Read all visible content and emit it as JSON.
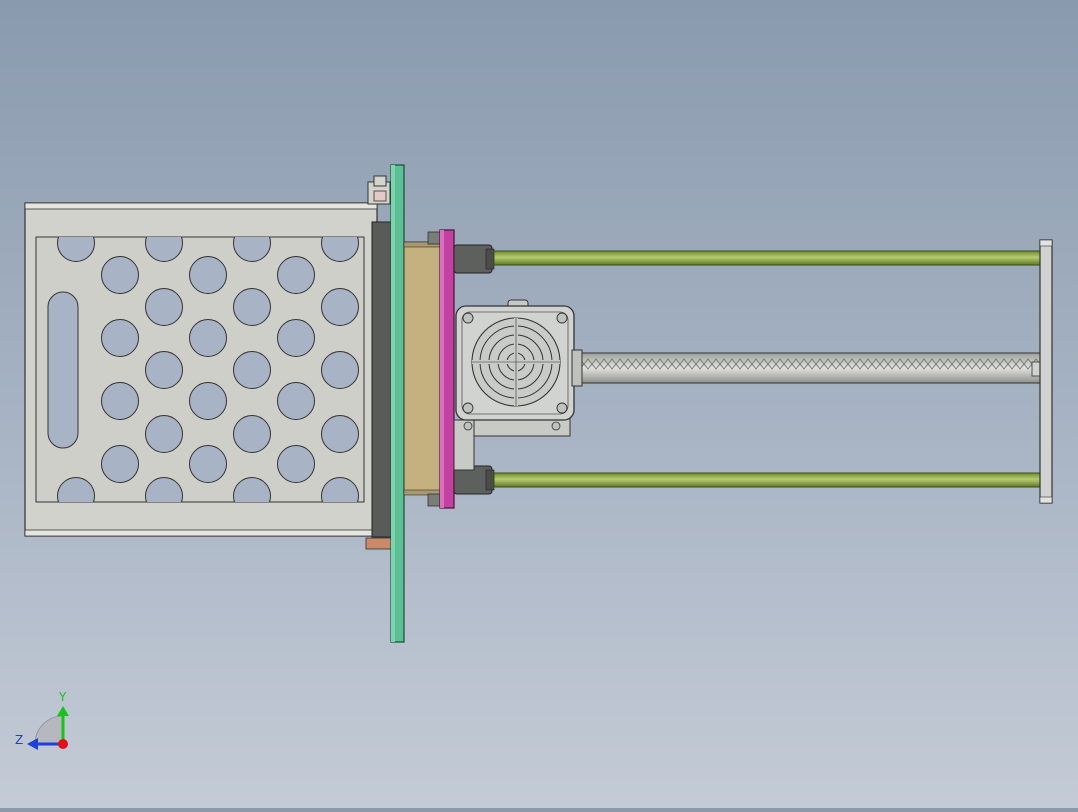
{
  "viewport": {
    "background_top": "#8a9aae",
    "background_bottom": "#c4cbd6"
  },
  "triad": {
    "axis_y_label": "Y",
    "axis_z_label": "Z",
    "y_color": "#19c419",
    "z_color": "#1f3fd8",
    "origin_color": "#e0101a"
  },
  "model": {
    "parts": [
      {
        "name": "perforated-tray",
        "color": "#d4d4ce"
      },
      {
        "name": "mounting-plate",
        "color": "#5cbf96"
      },
      {
        "name": "rubber-pad",
        "color": "#595b58"
      },
      {
        "name": "carriage-block",
        "color": "#c4b17f"
      },
      {
        "name": "motor-flange",
        "color": "#c341a0"
      },
      {
        "name": "stepper-motor",
        "color": "#d1d3d0"
      },
      {
        "name": "guide-rod",
        "color": "#94ab4e"
      },
      {
        "name": "lead-screw",
        "color": "#c7c9c4"
      },
      {
        "name": "end-plate",
        "color": "#d1d3d0"
      }
    ]
  }
}
